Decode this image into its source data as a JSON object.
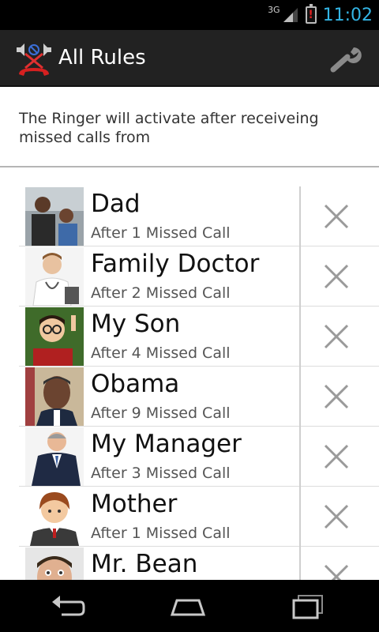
{
  "status_bar": {
    "network": "3G",
    "time": "11:02",
    "colors": {
      "time": "#33b5e5",
      "battery_alert": "#e02020"
    }
  },
  "action_bar": {
    "title": "All Rules",
    "app_icon": "muted-phone-icon",
    "settings_icon": "wrench-icon"
  },
  "description": "The Ringer will activate after receiveing missed calls from",
  "rules": [
    {
      "name": "Dad",
      "subtitle": "After 1 Missed Call",
      "avatar": "photo-father-and-son"
    },
    {
      "name": "Family Doctor",
      "subtitle": "After 2 Missed Call",
      "avatar": "photo-doctor"
    },
    {
      "name": "My Son",
      "subtitle": "After 4 Missed Call",
      "avatar": "photo-boy-with-glasses"
    },
    {
      "name": "Obama",
      "subtitle": "After 9 Missed Call",
      "avatar": "photo-obama"
    },
    {
      "name": "My Manager",
      "subtitle": "After 3 Missed Call",
      "avatar": "photo-businessman"
    },
    {
      "name": "Mother",
      "subtitle": "After 1 Missed Call",
      "avatar": "cartoon-avatar"
    },
    {
      "name": "Mr. Bean",
      "subtitle": "",
      "avatar": "photo-mr-bean"
    }
  ],
  "nav_bar": {
    "back_icon": "back-icon",
    "home_icon": "home-icon",
    "recents_icon": "recents-icon"
  }
}
